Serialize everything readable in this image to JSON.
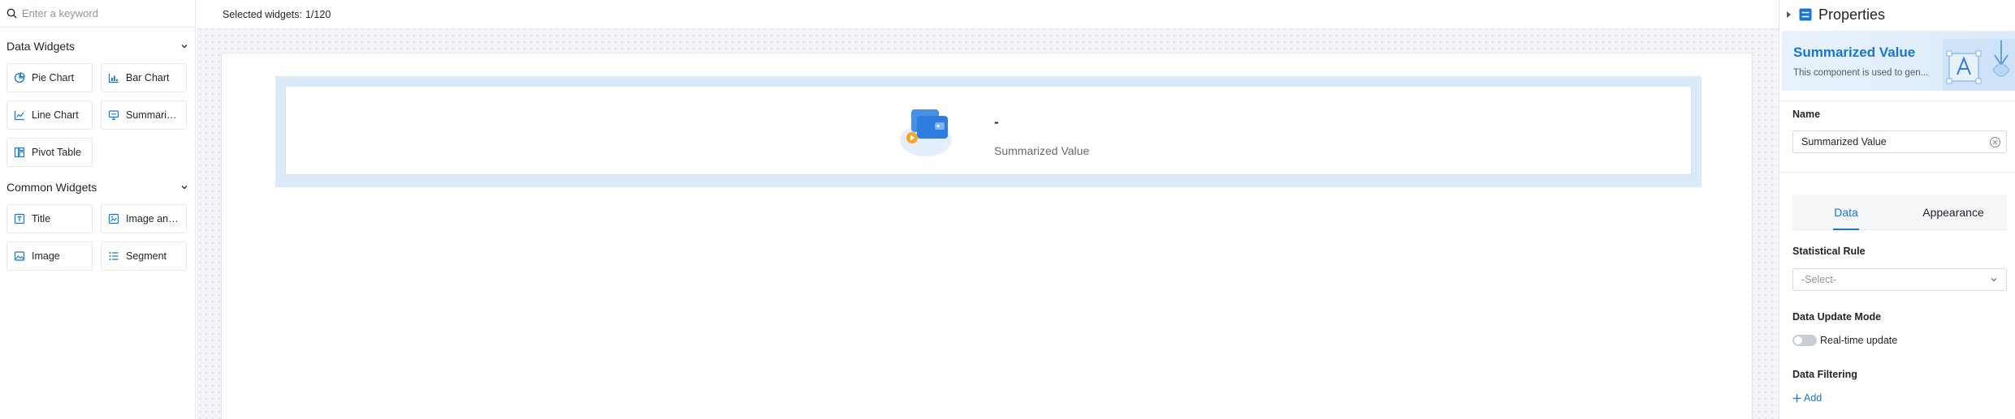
{
  "left_panel": {
    "search": {
      "placeholder": "Enter a keyword"
    },
    "groups": [
      {
        "title": "Data Widgets",
        "items": [
          {
            "label": "Pie Chart",
            "icon": "pie-chart-icon"
          },
          {
            "label": "Bar Chart",
            "icon": "bar-chart-icon"
          },
          {
            "label": "Line Chart",
            "icon": "line-chart-icon"
          },
          {
            "label": "Summariz...",
            "icon": "monitor-icon"
          },
          {
            "label": "Pivot Table",
            "icon": "pivot-table-icon"
          }
        ]
      },
      {
        "title": "Common Widgets",
        "items": [
          {
            "label": "Title",
            "icon": "title-icon"
          },
          {
            "label": "Image and...",
            "icon": "image-text-icon"
          },
          {
            "label": "Image",
            "icon": "image-icon"
          },
          {
            "label": "Segment",
            "icon": "list-icon"
          }
        ]
      }
    ]
  },
  "canvas": {
    "toolbar": {
      "selected_label": "Selected widgets:",
      "selected_count": "1/120"
    },
    "widget": {
      "value": "-",
      "label": "Summarized Value"
    }
  },
  "right_panel": {
    "title": "Properties",
    "banner": {
      "title": "Summarized Value",
      "description": "This component is used to gen..."
    },
    "name_label": "Name",
    "name_value": "Summarized Value",
    "tabs": [
      {
        "label": "Data",
        "active": true
      },
      {
        "label": "Appearance",
        "active": false
      }
    ],
    "statistical_rule": {
      "label": "Statistical Rule",
      "placeholder": "-Select-"
    },
    "update_mode": {
      "label": "Data Update Mode",
      "toggle_label": "Real-time update",
      "enabled": false
    },
    "filtering": {
      "label": "Data Filtering",
      "add_label": "Add"
    }
  },
  "colors": {
    "accent": "#1677d2",
    "selection": "#dbeaf8",
    "border": "#e8eaed"
  }
}
